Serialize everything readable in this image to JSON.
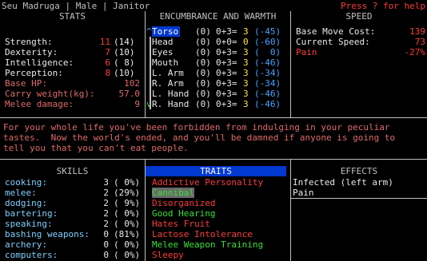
{
  "header": {
    "character": "Seu Madruga | Male | Janitor",
    "help": "Press ? for help"
  },
  "stats": {
    "title": "STATS",
    "rows": [
      {
        "label": "Strength:",
        "cur": "11",
        "base": "(14)"
      },
      {
        "label": "Dexterity:",
        "cur": "7",
        "base": "(10)"
      },
      {
        "label": "Intelligence:",
        "cur": "6",
        "base": "( 8)"
      },
      {
        "label": "Perception:",
        "cur": "8",
        "base": "(10)"
      }
    ],
    "derived": [
      {
        "label": "Base HP:",
        "value": "102"
      },
      {
        "label": "Carry weight(kg):",
        "value": "57.0"
      },
      {
        "label": "Melee damage:",
        "value": "9"
      }
    ]
  },
  "encumbrance": {
    "title": "ENCUMBRANCE AND WARMTH",
    "rows": [
      {
        "marker": "^",
        "part": "Torso",
        "enc": "(0)",
        "calc": "0+3=",
        "total": "3",
        "warmth": "(-45)"
      },
      {
        "marker": "",
        "part": "Head",
        "enc": "(0)",
        "calc": "0+0=",
        "total": "0",
        "warmth": "(-60)"
      },
      {
        "marker": "",
        "part": "Eyes",
        "enc": "(0)",
        "calc": "0+3=",
        "total": "3",
        "warmth": "(  0)"
      },
      {
        "marker": "",
        "part": "Mouth",
        "enc": "(0)",
        "calc": "0+3=",
        "total": "3",
        "warmth": "(-46)"
      },
      {
        "marker": "",
        "part": "L. Arm",
        "enc": "(0)",
        "calc": "0+3=",
        "total": "3",
        "warmth": "(-34)"
      },
      {
        "marker": "",
        "part": "R. Arm",
        "enc": "(0)",
        "calc": "0+3=",
        "total": "3",
        "warmth": "(-34)"
      },
      {
        "marker": "",
        "part": "L. Hand",
        "enc": "(0)",
        "calc": "0+3=",
        "total": "3",
        "warmth": "(-46)"
      },
      {
        "marker": "v",
        "part": "R. Hand",
        "enc": "(0)",
        "calc": "0+3=",
        "total": "3",
        "warmth": "(-46)"
      }
    ]
  },
  "speed": {
    "title": "SPEED",
    "rows": [
      {
        "label": "Base Move Cost:",
        "value": "139"
      },
      {
        "label": "Current Speed:",
        "value": "73"
      },
      {
        "label": "Pain",
        "value": "-27%"
      }
    ]
  },
  "description": "For your whole life you've been forbidden from indulging in your peculiar\ntastes.  Now the world's ended, and you'll be damned if anyone is going to\ntell you that you can't eat people.",
  "skills": {
    "title": "SKILLS",
    "rows": [
      {
        "label": "cooking:",
        "level": "3",
        "pct": "( 0%)"
      },
      {
        "label": "melee:",
        "level": "2",
        "pct": "(29%)"
      },
      {
        "label": "dodging:",
        "level": "2",
        "pct": "( 9%)"
      },
      {
        "label": "bartering:",
        "level": "2",
        "pct": "( 0%)"
      },
      {
        "label": "speaking:",
        "level": "2",
        "pct": "( 0%)"
      },
      {
        "label": "bashing weapons:",
        "level": "0",
        "pct": "(81%)"
      },
      {
        "label": "archery:",
        "level": "0",
        "pct": "( 0%)"
      },
      {
        "label": "computers:",
        "level": "0",
        "pct": "( 0%)"
      }
    ]
  },
  "traits": {
    "title": "TRAITS",
    "items": [
      {
        "name": "Addictive Personality",
        "color": "#ff3b3b"
      },
      {
        "name": "Cannibal",
        "color": "#38e038"
      },
      {
        "name": "Disorganized",
        "color": "#ff3b3b"
      },
      {
        "name": "Good Hearing",
        "color": "#38e038"
      },
      {
        "name": "Hates Fruit",
        "color": "#ff3b3b"
      },
      {
        "name": "Lactose Intolerance",
        "color": "#ff3b3b"
      },
      {
        "name": "Melee Weapon Training",
        "color": "#38e038"
      },
      {
        "name": "Sleepy",
        "color": "#ff3b3b"
      }
    ]
  },
  "effects": {
    "title": "EFFECTS",
    "items": [
      "Infected (left arm)",
      "Pain"
    ]
  }
}
